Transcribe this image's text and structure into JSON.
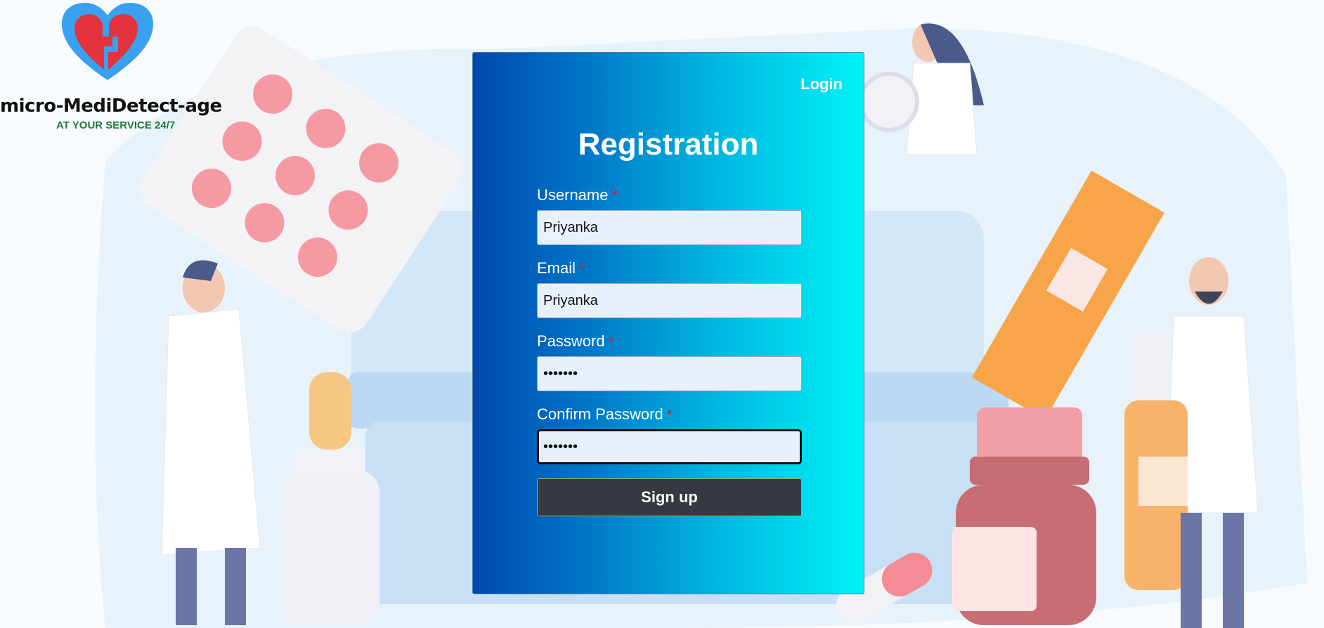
{
  "brand": {
    "name": "micro-MediDetect-age",
    "tagline": "AT YOUR SERVICE 24/7"
  },
  "nav": {
    "login_label": "Login"
  },
  "form": {
    "title": "Registration",
    "required_mark": "*",
    "fields": [
      {
        "label": "Username",
        "value": "Priyanka",
        "type": "text"
      },
      {
        "label": "Email",
        "value": "Priyanka",
        "type": "text"
      },
      {
        "label": "Password",
        "value": "1234567",
        "type": "password"
      },
      {
        "label": "Confirm Password",
        "value": "1234567",
        "type": "password"
      }
    ],
    "submit_label": "Sign up"
  },
  "colors": {
    "card_gradient_start": "#0048ad",
    "card_gradient_end": "#00f3f6",
    "button_bg": "#343a40",
    "required": "#e0182b",
    "input_bg": "#e8f0fe"
  }
}
